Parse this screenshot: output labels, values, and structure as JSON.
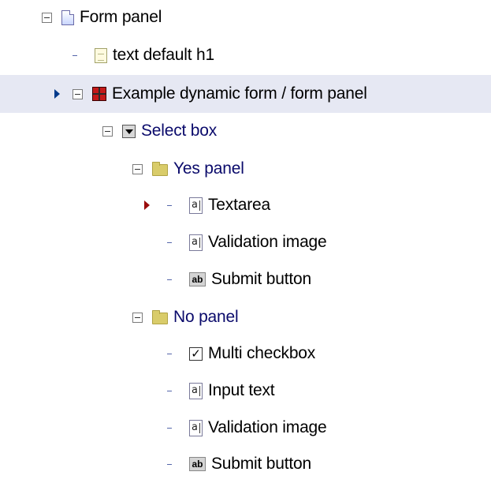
{
  "tree": {
    "nodes": [
      {
        "label": "Form panel",
        "icon": "page-icon"
      },
      {
        "label": "text default h1",
        "icon": "document-icon"
      },
      {
        "label": "Example dynamic form / form panel",
        "icon": "grid-form-icon"
      },
      {
        "label": "Select box",
        "icon": "select-box-icon"
      },
      {
        "label": "Yes panel",
        "icon": "folder-icon"
      },
      {
        "label": "Textarea",
        "icon": "text-field-icon"
      },
      {
        "label": "Validation image",
        "icon": "text-field-icon"
      },
      {
        "label": "Submit button",
        "icon": "button-icon"
      },
      {
        "label": "No panel",
        "icon": "folder-icon"
      },
      {
        "label": "Multi checkbox",
        "icon": "checkbox-icon"
      },
      {
        "label": "Input text",
        "icon": "text-field-icon"
      },
      {
        "label": "Validation image",
        "icon": "text-field-icon"
      },
      {
        "label": "Submit button",
        "icon": "button-icon"
      }
    ],
    "icon_glyphs": {
      "text_field": "a",
      "button": "ab",
      "checkbox": "✓"
    }
  }
}
